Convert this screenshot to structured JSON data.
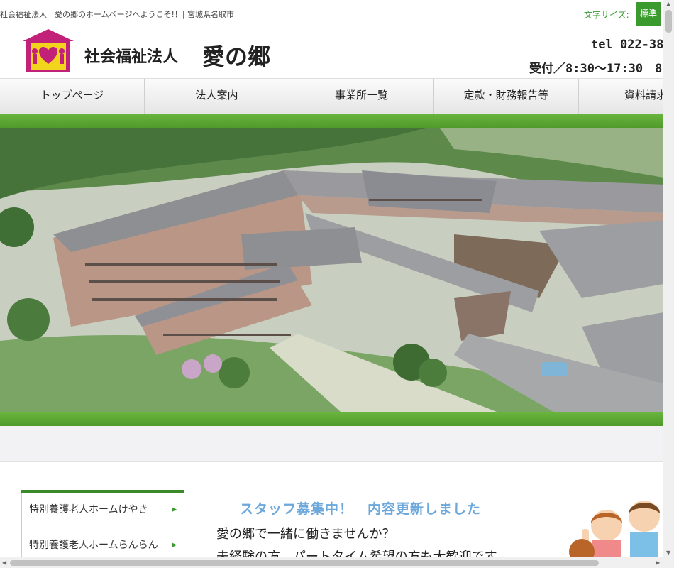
{
  "header": {
    "tagline": "社会福祉法人　愛の郷のホームページへようこそ!！| 宮城県名取市",
    "font_size_label": "文字サイズ:",
    "font_size_button": "標準",
    "logo_corp": "社会福祉法人",
    "logo_name": "愛の郷",
    "tel": "tel 022-38",
    "hours": "受付／8:30〜17:30　8"
  },
  "nav": {
    "items": [
      {
        "label": "トップページ"
      },
      {
        "label": "法人案内"
      },
      {
        "label": "事業所一覧"
      },
      {
        "label": "定款・財務報告等"
      },
      {
        "label": "資料請求に"
      }
    ]
  },
  "sidebar": {
    "items": [
      {
        "label": "特別養護老人ホームけやき"
      },
      {
        "label": "特別養護老人ホームらんらん"
      }
    ]
  },
  "main": {
    "news_title": "スタッフ募集中！　内容更新しました",
    "line1": "愛の郷で一緒に働きませんか？",
    "line2": "未経験の方、パートタイム希望の方も大歓迎です"
  },
  "colors": {
    "accent": "#3a9a2e",
    "logo_pink": "#c2217a",
    "logo_yellow": "#f2d41c",
    "news_blue": "#6da8dc"
  },
  "icons": [
    "house-heart-logo-icon",
    "chevron-right-icon",
    "staff-illustration-icon"
  ]
}
